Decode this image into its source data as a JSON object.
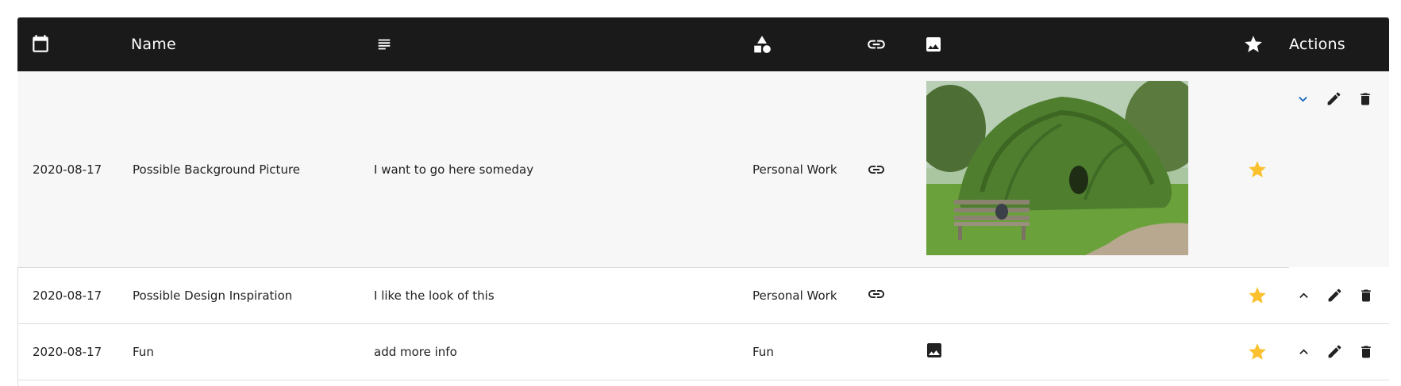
{
  "header": {
    "name_label": "Name",
    "actions_label": "Actions",
    "icons": [
      "calendar-icon",
      "notes-icon",
      "category-shapes-icon",
      "link-icon",
      "image-icon",
      "star-icon"
    ]
  },
  "colors": {
    "header_bg": "#1a1a1a",
    "star": "#fbc02d",
    "expand_chevron": "#1565c0",
    "row_expanded_bg": "#f7f7f7"
  },
  "rows": [
    {
      "date": "2020-08-17",
      "name": "Possible Background Picture",
      "description": "I want to go here someday",
      "category": "Personal Work",
      "has_link": true,
      "has_image": true,
      "image_preview": "weeping-tree-with-bench-photo",
      "starred": true,
      "expanded": true
    },
    {
      "date": "2020-08-17",
      "name": "Possible Design Inspiration",
      "description": "I like the look of this",
      "category": "Personal Work",
      "has_link": true,
      "has_image": false,
      "starred": true,
      "expanded": false
    },
    {
      "date": "2020-08-17",
      "name": "Fun",
      "description": "add more info",
      "category": "Fun",
      "has_link": false,
      "has_image": true,
      "starred": true,
      "expanded": false
    }
  ]
}
